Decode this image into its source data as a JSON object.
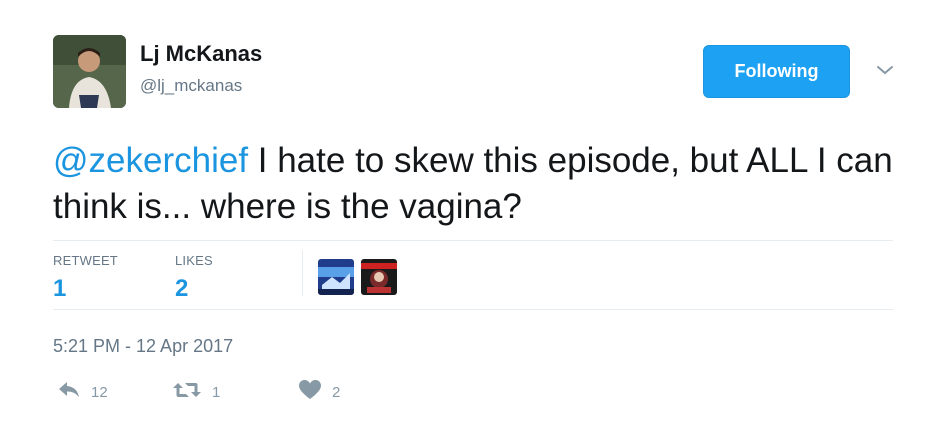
{
  "user": {
    "name": "Lj McKanas",
    "handle": "@lj_mckanas",
    "follow_label": "Following"
  },
  "tweet": {
    "mention": "@zekerchief",
    "text": " I hate to skew this episode, but ALL I can think is... where is the vagina?",
    "timestamp": "5:21 PM - 12 Apr 2017"
  },
  "stats": {
    "retweets_label": "RETWEET",
    "retweets_value": "1",
    "likes_label": "LIKES",
    "likes_value": "2"
  },
  "actions": {
    "reply_count": "12",
    "retweet_count": "1",
    "like_count": "2"
  },
  "colors": {
    "accent": "#1da1f2",
    "link": "#1b95e0",
    "muted": "#657786",
    "icon": "#8899a6"
  },
  "icons": [
    "reply-icon",
    "retweet-icon",
    "heart-icon",
    "chevron-down-icon"
  ]
}
